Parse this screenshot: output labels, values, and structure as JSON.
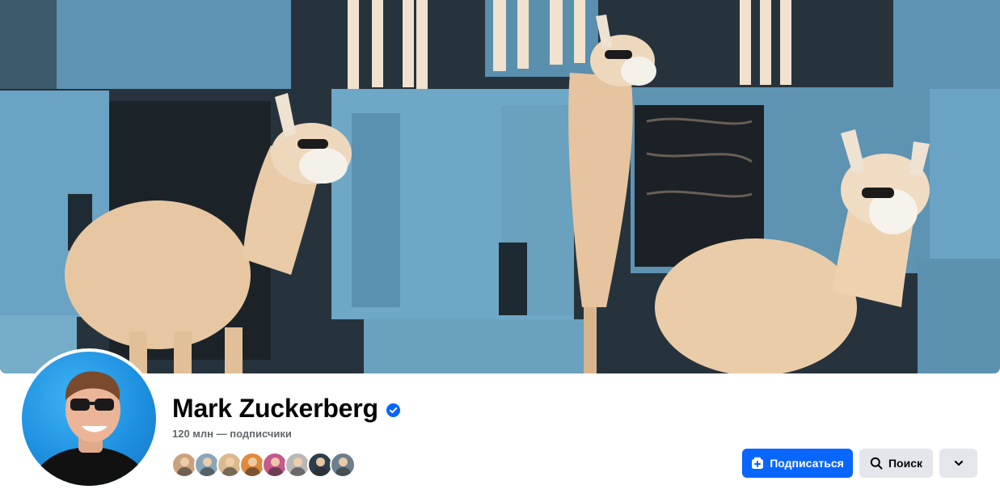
{
  "profile": {
    "name": "Mark Zuckerberg",
    "verified": true,
    "followers_text": "120 млн — подписчики"
  },
  "cover": {
    "description_icon": "cover-photo"
  },
  "friends": {
    "avatar_colors": [
      "#c9a27e",
      "#8aa6b8",
      "#d9b98f",
      "#e08a3c",
      "#c45a8d",
      "#b8b8b8",
      "#2f3d4a",
      "#6b7f8c"
    ]
  },
  "actions": {
    "subscribe_label": "Подписаться",
    "subscribe_icon": "follow-plus-icon",
    "search_label": "Поиск",
    "search_icon": "search-icon",
    "more_icon": "chevron-down-icon"
  },
  "colors": {
    "accent": "#0866ff",
    "secondary_button": "#e4e6eb",
    "verified_badge": "#0866ff",
    "muted_text": "#65676b"
  }
}
